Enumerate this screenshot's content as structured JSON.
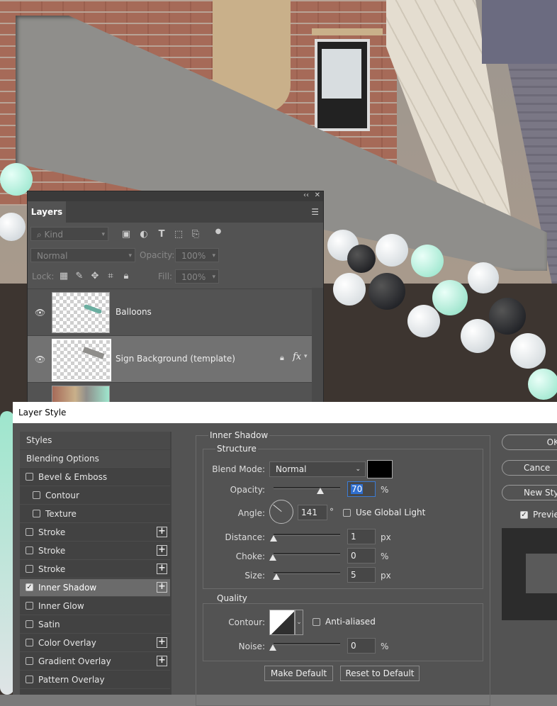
{
  "layers_panel": {
    "collapse_icon": "double-chevron-left-icon",
    "close_icon": "close-icon",
    "tab_label": "Layers",
    "filter_kind": "Kind",
    "blend_mode": "Normal",
    "opacity_label": "Opacity:",
    "opacity_value": "100%",
    "lock_label": "Lock:",
    "fill_label": "Fill:",
    "fill_value": "100%",
    "layers": [
      {
        "name": "Balloons",
        "visible": true,
        "active": false
      },
      {
        "name": "Sign Background (template)",
        "visible": true,
        "active": true,
        "locked": true,
        "fx": "fx"
      }
    ]
  },
  "layer_style": {
    "title": "Layer Style",
    "styles_list": [
      {
        "label": "Styles",
        "type": "header"
      },
      {
        "label": "Blending Options",
        "type": "header"
      },
      {
        "label": "Bevel & Emboss",
        "checked": false
      },
      {
        "label": "Contour",
        "checked": false,
        "indent": true
      },
      {
        "label": "Texture",
        "checked": false,
        "indent": true
      },
      {
        "label": "Stroke",
        "checked": false,
        "plus": true
      },
      {
        "label": "Stroke",
        "checked": false,
        "plus": true
      },
      {
        "label": "Stroke",
        "checked": false,
        "plus": true
      },
      {
        "label": "Inner Shadow",
        "checked": true,
        "plus": true,
        "active": true
      },
      {
        "label": "Inner Glow",
        "checked": false
      },
      {
        "label": "Satin",
        "checked": false
      },
      {
        "label": "Color Overlay",
        "checked": false,
        "plus": true
      },
      {
        "label": "Gradient Overlay",
        "checked": false,
        "plus": true
      },
      {
        "label": "Pattern Overlay",
        "checked": false
      }
    ],
    "section_title": "Inner Shadow",
    "structure": {
      "title": "Structure",
      "blend_mode_label": "Blend Mode:",
      "blend_mode_value": "Normal",
      "shadow_color": "#000000",
      "opacity_label": "Opacity:",
      "opacity_value": "70",
      "opacity_fraction": 0.7,
      "opacity_unit": "%",
      "angle_label": "Angle:",
      "angle_value": "141",
      "angle_deg": 141,
      "angle_unit": "°",
      "global_light_label": "Use Global Light",
      "global_light_checked": false,
      "distance_label": "Distance:",
      "distance_value": "1",
      "distance_unit": "px",
      "choke_label": "Choke:",
      "choke_value": "0",
      "choke_unit": "%",
      "size_label": "Size:",
      "size_value": "5",
      "size_unit": "px"
    },
    "quality": {
      "title": "Quality",
      "contour_label": "Contour:",
      "anti_aliased_label": "Anti-aliased",
      "anti_aliased_checked": false,
      "noise_label": "Noise:",
      "noise_value": "0",
      "noise_unit": "%"
    },
    "make_default_label": "Make Default",
    "reset_default_label": "Reset to Default",
    "ok_label": "OK",
    "cancel_label": "Cance",
    "new_style_label": "New Sty",
    "preview_label": "Previe",
    "preview_checked": true
  }
}
